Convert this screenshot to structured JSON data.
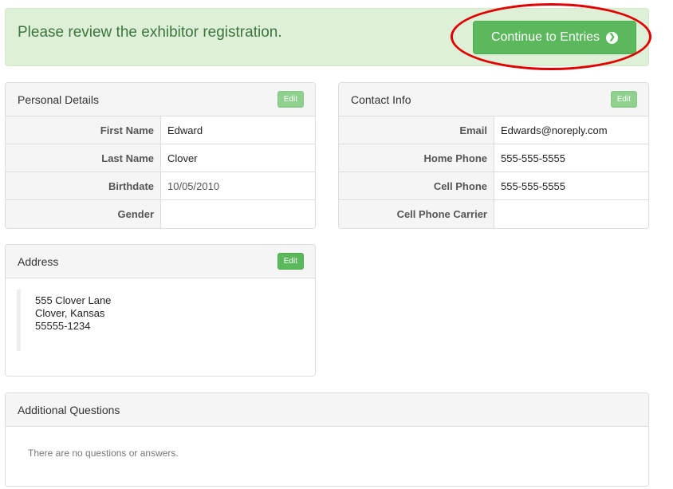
{
  "alert": {
    "message": "Please review the exhibitor registration.",
    "continue_label": "Continue to Entries",
    "continue_icon": "arrow-circle-right-icon"
  },
  "personal": {
    "title": "Personal Details",
    "edit_label": "Edit",
    "rows": [
      {
        "label": "First Name",
        "value": "Edward"
      },
      {
        "label": "Last Name",
        "value": "Clover"
      },
      {
        "label": "Birthdate",
        "value": "10/05/2010"
      },
      {
        "label": "Gender",
        "value": ""
      }
    ]
  },
  "contact": {
    "title": "Contact Info",
    "edit_label": "Edit",
    "rows": [
      {
        "label": "Email",
        "value": "Edwards@noreply.com"
      },
      {
        "label": "Home Phone",
        "value": "555-555-5555"
      },
      {
        "label": "Cell Phone",
        "value": "555-555-5555"
      },
      {
        "label": "Cell Phone Carrier",
        "value": ""
      }
    ]
  },
  "address": {
    "title": "Address",
    "edit_label": "Edit",
    "line1": "555 Clover Lane",
    "line2": "Clover, Kansas",
    "line3": "55555-1234"
  },
  "questions": {
    "title": "Additional Questions",
    "empty_text": "There are no questions or answers."
  },
  "colors": {
    "success": "#5cb85c",
    "alert_bg": "#dff0d8",
    "alert_text": "#3c763d",
    "highlight": "#e00000"
  }
}
